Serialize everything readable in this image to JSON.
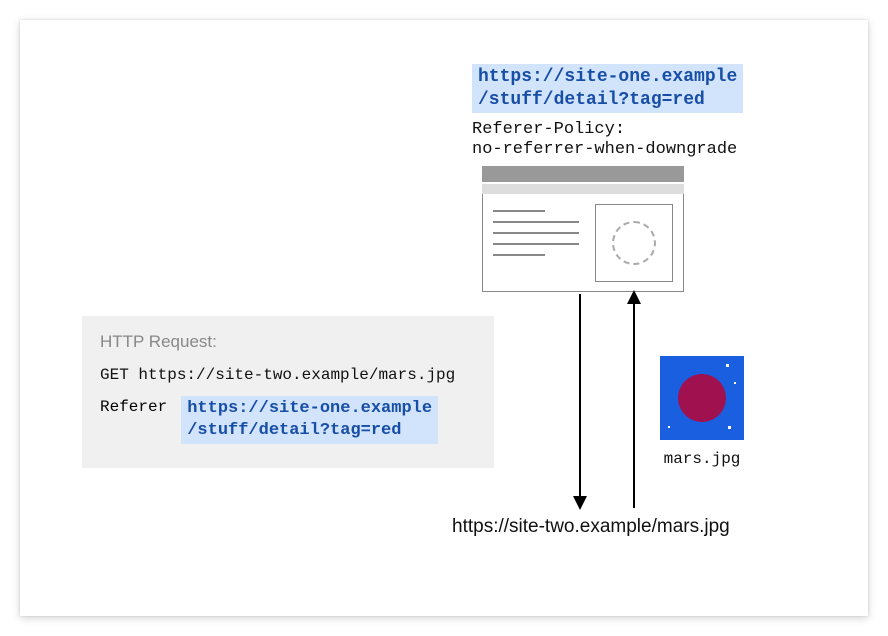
{
  "top_url": {
    "line1": "https://site-one.example",
    "line2": "/stuff/detail?tag=red"
  },
  "policy": {
    "label": "Referer-Policy:",
    "value": "no-referrer-when-downgrade"
  },
  "bottom_url": "https://site-two.example/mars.jpg",
  "mars": {
    "filename": "mars.jpg"
  },
  "http": {
    "title": "HTTP Request:",
    "get_line": "GET https://site-two.example/mars.jpg",
    "referer_label": "Referer",
    "referer_url_line1": "https://site-one.example",
    "referer_url_line2": "/stuff/detail?tag=red"
  }
}
